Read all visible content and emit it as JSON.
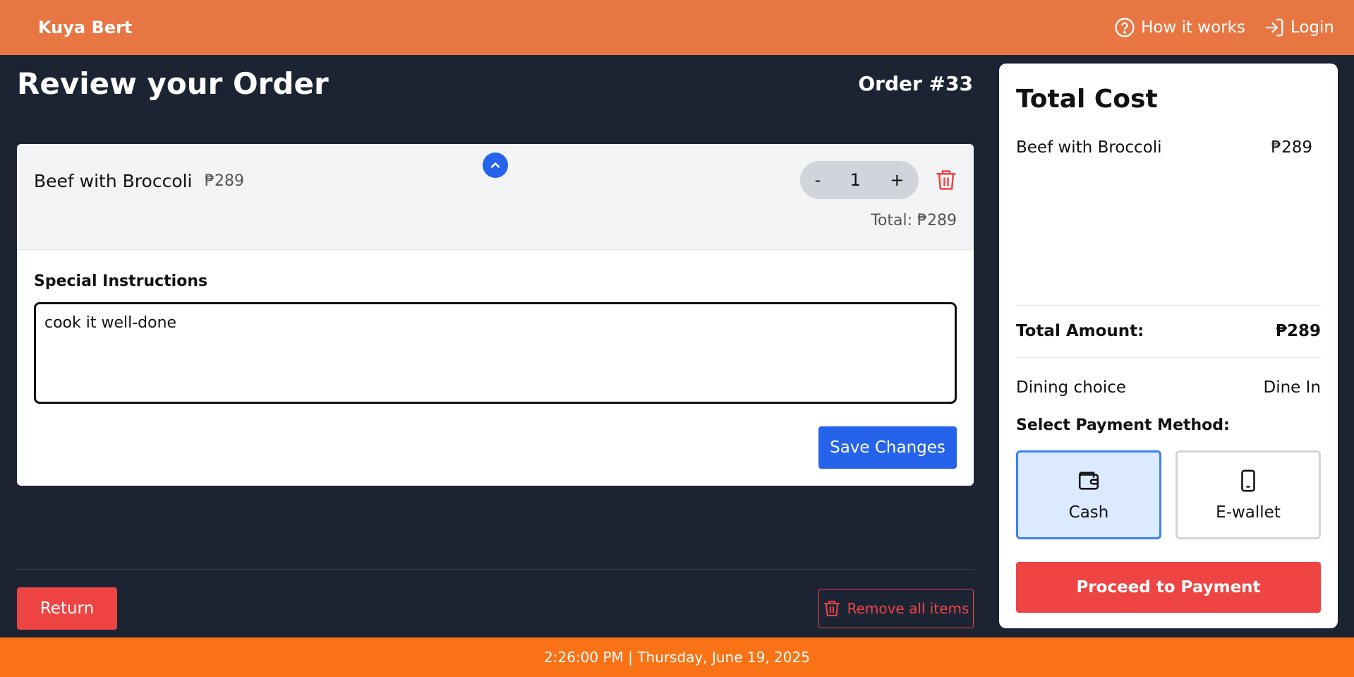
{
  "header": {
    "brand": "Kuya Bert",
    "nav": [
      {
        "label": "How it works",
        "icon": "question-circle-icon"
      },
      {
        "label": "Login",
        "icon": "login-icon"
      }
    ]
  },
  "page": {
    "title": "Review your Order",
    "order_number": "Order #33"
  },
  "item": {
    "name": "Beef with Broccoli",
    "price": "₱289",
    "quantity_minus": "-",
    "quantity": "1",
    "quantity_plus": "+",
    "total": "Total: ₱289",
    "instructions_label": "Special Instructions",
    "instructions_value": "cook it well-done",
    "save_label": "Save Changes"
  },
  "actions": {
    "return_label": "Return",
    "remove_all_label": "Remove all items"
  },
  "summary": {
    "title": "Total Cost",
    "items": [
      {
        "name": "Beef with Broccoli",
        "price": "₱289"
      }
    ],
    "total_label": "Total Amount:",
    "total_value": "₱289",
    "dining_label": "Dining choice",
    "dining_value": "Dine In",
    "payment_label": "Select Payment Method:",
    "payment_options": [
      {
        "label": "Cash",
        "icon": "wallet-icon",
        "selected": true
      },
      {
        "label": "E-wallet",
        "icon": "phone-icon",
        "selected": false
      }
    ],
    "proceed_label": "Proceed to Payment"
  },
  "footer": {
    "datetime": "2:26:00 PM | Thursday, June 19, 2025"
  },
  "colors": {
    "header": "#e87642",
    "footer": "#f97316",
    "background": "#1c2434",
    "primary": "#2563eb",
    "danger": "#ef4444",
    "selected_bg": "#dbeafe"
  }
}
